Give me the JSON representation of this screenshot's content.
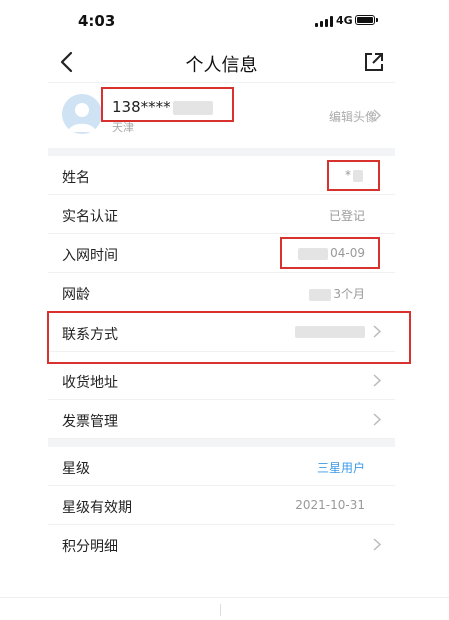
{
  "status_bar": {
    "time": "4:03",
    "network": "4G"
  },
  "nav": {
    "title": "个人信息"
  },
  "profile": {
    "phone": "138****",
    "region": "天津",
    "edit_label": "编辑头像"
  },
  "rows": [
    {
      "label": "姓名",
      "value": "*"
    },
    {
      "label": "实名认证",
      "value": "已登记"
    },
    {
      "label": "入网时间",
      "value": "04-09"
    },
    {
      "label": "网龄",
      "value": "3个月"
    },
    {
      "label": "联系方式",
      "value": ""
    },
    {
      "label": "收货地址",
      "value": ""
    },
    {
      "label": "发票管理",
      "value": ""
    },
    {
      "label": "星级",
      "value": "三星用户"
    },
    {
      "label": "星级有效期",
      "value": "2021-10-31"
    },
    {
      "label": "积分明细",
      "value": ""
    }
  ],
  "colors": {
    "accent": "#3b9be8",
    "highlight": "#d8322f"
  },
  "icons": [
    "back-arrow-icon",
    "share-icon",
    "avatar-icon",
    "chevron-right-icon",
    "signal-icon",
    "battery-icon"
  ]
}
